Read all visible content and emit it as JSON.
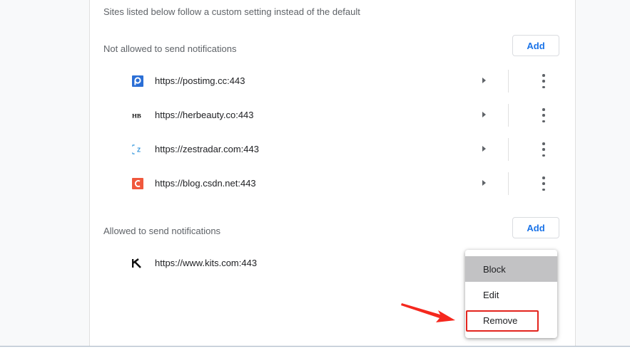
{
  "intro_text": "Sites listed below follow a custom setting instead of the default",
  "blocked": {
    "label": "Not allowed to send notifications",
    "add_label": "Add",
    "sites": [
      {
        "url": "https://postimg.cc:443",
        "icon": "postimg-favicon"
      },
      {
        "url": "https://herbeauty.co:443",
        "icon": "herbeauty-favicon"
      },
      {
        "url": "https://zestradar.com:443",
        "icon": "zestradar-favicon"
      },
      {
        "url": "https://blog.csdn.net:443",
        "icon": "csdn-favicon"
      }
    ]
  },
  "allowed": {
    "label": "Allowed to send notifications",
    "add_label": "Add",
    "sites": [
      {
        "url": "https://www.kits.com:443",
        "icon": "kits-favicon"
      }
    ]
  },
  "context_menu": {
    "items": [
      "Block",
      "Edit",
      "Remove"
    ],
    "highlighted": "Block",
    "outlined": "Remove"
  },
  "annotation": {
    "arrow_color": "#f5281e",
    "box_color": "#e3241d"
  },
  "colors": {
    "accent": "#1a73e8",
    "text": "#202124",
    "secondary_text": "#5f6368"
  }
}
